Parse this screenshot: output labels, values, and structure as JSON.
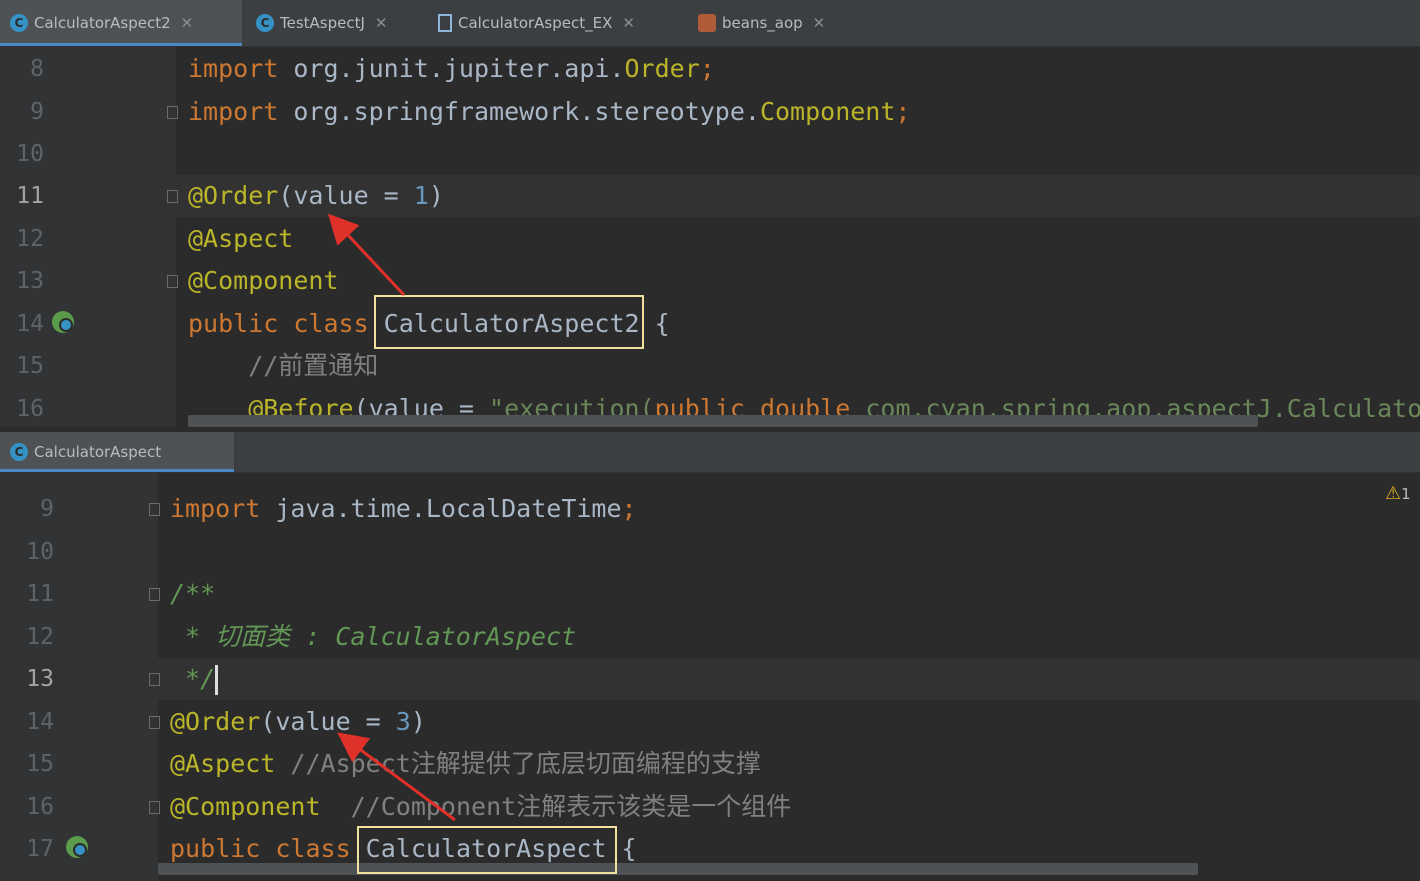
{
  "top_tabs": [
    {
      "label": "CalculatorAspect2",
      "icon": "class-c-icon",
      "active": true
    },
    {
      "label": "TestAspectJ",
      "icon": "class-c-run-icon",
      "active": false
    },
    {
      "label": "CalculatorAspect_EX",
      "icon": "java-file-icon",
      "active": false
    },
    {
      "label": "beans_aop",
      "icon": "spring-xml-icon",
      "active": false
    }
  ],
  "top_editor": {
    "lines": [
      {
        "num": "8",
        "tokens": [
          [
            "kw",
            "import "
          ],
          [
            "plain",
            "org.junit.jupiter.api."
          ],
          [
            "ann",
            "Order"
          ],
          [
            "kw",
            ";"
          ]
        ]
      },
      {
        "num": "9",
        "tokens": [
          [
            "kw",
            "import "
          ],
          [
            "plain",
            "org.springframework.stereotype."
          ],
          [
            "ann",
            "Component"
          ],
          [
            "kw",
            ";"
          ]
        ]
      },
      {
        "num": "10",
        "tokens": []
      },
      {
        "num": "11",
        "tokens": [
          [
            "ann",
            "@Order"
          ],
          [
            "plain",
            "(value = "
          ],
          [
            "num",
            "1"
          ],
          [
            "plain",
            ")"
          ]
        ]
      },
      {
        "num": "12",
        "tokens": [
          [
            "ann",
            "@Aspect"
          ]
        ]
      },
      {
        "num": "13",
        "tokens": [
          [
            "ann",
            "@Component"
          ]
        ]
      },
      {
        "num": "14",
        "tokens": [
          [
            "kw",
            "public class "
          ],
          [
            "plain",
            "CalculatorAspect2 {"
          ]
        ]
      },
      {
        "num": "15",
        "tokens": [
          [
            "cmt",
            "    //前置通知"
          ]
        ]
      },
      {
        "num": "16",
        "tokens": [
          [
            "ann",
            "    @Before"
          ],
          [
            "plain",
            "(value = "
          ],
          [
            "str",
            "\"execution("
          ],
          [
            "kw",
            "public double "
          ],
          [
            "str",
            "com.cyan.spring.aop.aspectJ.Calculator"
          ]
        ]
      }
    ]
  },
  "bottom_tab": {
    "label": "CalculatorAspect",
    "icon": "class-c-icon"
  },
  "bottom_editor": {
    "lines": [
      {
        "num": "9",
        "tokens": [
          [
            "kw",
            "import "
          ],
          [
            "plain",
            "java.time.LocalDateTime"
          ],
          [
            "kw",
            ";"
          ]
        ]
      },
      {
        "num": "10",
        "tokens": []
      },
      {
        "num": "11",
        "tokens": [
          [
            "doc",
            "/**"
          ]
        ]
      },
      {
        "num": "12",
        "tokens": [
          [
            "doc",
            " * 切面类 : CalculatorAspect"
          ]
        ]
      },
      {
        "num": "13",
        "tokens": [
          [
            "doc",
            " */"
          ]
        ]
      },
      {
        "num": "14",
        "tokens": [
          [
            "ann",
            "@Order"
          ],
          [
            "plain",
            "(value = "
          ],
          [
            "num",
            "3"
          ],
          [
            "plain",
            ")"
          ]
        ]
      },
      {
        "num": "15",
        "tokens": [
          [
            "ann",
            "@Aspect "
          ],
          [
            "cmt",
            "//Aspect注解提供了底层切面编程的支撑"
          ]
        ]
      },
      {
        "num": "16",
        "tokens": [
          [
            "ann",
            "@Component  "
          ],
          [
            "cmt",
            "//Component注解表示该类是一个组件"
          ]
        ]
      },
      {
        "num": "17",
        "tokens": [
          [
            "kw",
            "public class "
          ],
          [
            "plain",
            "CalculatorAspect {"
          ]
        ]
      }
    ],
    "warning_count": "1"
  },
  "colors": {
    "keyword": "#cc7832",
    "annotation": "#bbb529",
    "number": "#6897bb",
    "string": "#6a8759",
    "comment": "#808080",
    "highlight_box": "#f0e0a0",
    "arrow": "#e0302a"
  }
}
